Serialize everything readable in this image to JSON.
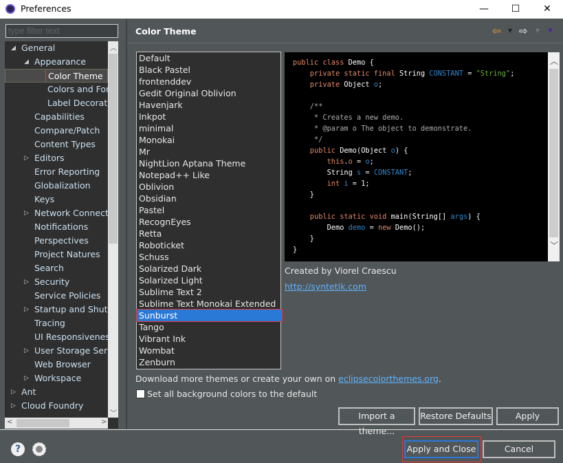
{
  "window": {
    "title": "Preferences",
    "minimize": "—",
    "maximize": "☐",
    "close": "✕"
  },
  "filter": {
    "placeholder": "type filter text"
  },
  "tree": [
    {
      "label": "General",
      "level": 0,
      "arrow": "expanded"
    },
    {
      "label": "Appearance",
      "level": 1,
      "arrow": "expanded"
    },
    {
      "label": "Color Theme",
      "level": 2,
      "selected": true
    },
    {
      "label": "Colors and Fonts",
      "level": 2
    },
    {
      "label": "Label Decorations",
      "level": 2
    },
    {
      "label": "Capabilities",
      "level": 1
    },
    {
      "label": "Compare/Patch",
      "level": 1
    },
    {
      "label": "Content Types",
      "level": 1
    },
    {
      "label": "Editors",
      "level": 1,
      "arrow": "collapsed"
    },
    {
      "label": "Error Reporting",
      "level": 1
    },
    {
      "label": "Globalization",
      "level": 1
    },
    {
      "label": "Keys",
      "level": 1
    },
    {
      "label": "Network Connections",
      "level": 1,
      "arrow": "collapsed"
    },
    {
      "label": "Notifications",
      "level": 1
    },
    {
      "label": "Perspectives",
      "level": 1
    },
    {
      "label": "Project Natures",
      "level": 1
    },
    {
      "label": "Search",
      "level": 1
    },
    {
      "label": "Security",
      "level": 1,
      "arrow": "collapsed"
    },
    {
      "label": "Service Policies",
      "level": 1
    },
    {
      "label": "Startup and Shutdown",
      "level": 1,
      "arrow": "collapsed"
    },
    {
      "label": "Tracing",
      "level": 1
    },
    {
      "label": "UI Responsiveness",
      "level": 1
    },
    {
      "label": "User Storage Service",
      "level": 1,
      "arrow": "collapsed"
    },
    {
      "label": "Web Browser",
      "level": 1
    },
    {
      "label": "Workspace",
      "level": 1,
      "arrow": "collapsed"
    },
    {
      "label": "Ant",
      "level": 0,
      "arrow": "collapsed"
    },
    {
      "label": "Cloud Foundry",
      "level": 0,
      "arrow": "collapsed"
    }
  ],
  "page": {
    "title": "Color Theme",
    "toolbar_icons": [
      "back-arrow-icon",
      "forward-arrow-icon",
      "view-menu-icon"
    ]
  },
  "themes": [
    "Default",
    "Black Pastel",
    "frontenddev",
    "Gedit Original Oblivion",
    "Havenjark",
    "Inkpot",
    "minimal",
    "Monokai",
    "Mr",
    "NightLion Aptana Theme",
    "Notepad++ Like",
    "Oblivion",
    "Obsidian",
    "Pastel",
    "RecognEyes",
    "Retta",
    "Roboticket",
    "Schuss",
    "Solarized Dark",
    "Solarized Light",
    "Sublime Text 2",
    "Sublime Text Monokai Extended",
    "Sunburst",
    "Tango",
    "Vibrant Ink",
    "Wombat",
    "Zenburn"
  ],
  "selected_theme": "Sunburst",
  "preview": {
    "code": [
      [
        [
          "kw",
          "public class "
        ],
        [
          "cls",
          "Demo"
        ],
        [
          "pl",
          " {"
        ]
      ],
      [
        [
          "kw",
          "    private static final "
        ],
        [
          "cls",
          "String "
        ],
        [
          "cst",
          "CONSTANT"
        ],
        [
          "pl",
          " = "
        ],
        [
          "str",
          "\"String\""
        ],
        [
          "pl",
          ";"
        ]
      ],
      [
        [
          "kw",
          "    private "
        ],
        [
          "cls",
          "Object "
        ],
        [
          "cst",
          "o"
        ],
        [
          "pl",
          ";"
        ]
      ],
      [
        [
          "pl",
          ""
        ]
      ],
      [
        [
          "cm",
          "    /**"
        ]
      ],
      [
        [
          "cm",
          "     * Creates a new demo."
        ]
      ],
      [
        [
          "cm",
          "     * @param o The object to demonstrate."
        ]
      ],
      [
        [
          "cm",
          "     */"
        ]
      ],
      [
        [
          "kw",
          "    public "
        ],
        [
          "cls",
          "Demo"
        ],
        [
          "pl",
          "("
        ],
        [
          "cls",
          "Object "
        ],
        [
          "cst",
          "o"
        ],
        [
          "pl",
          ") {"
        ]
      ],
      [
        [
          "kw",
          "        this"
        ],
        [
          "pl",
          "."
        ],
        [
          "kw",
          "o"
        ],
        [
          "pl",
          " = "
        ],
        [
          "cst",
          "o"
        ],
        [
          "pl",
          ";"
        ]
      ],
      [
        [
          "cls",
          "        String "
        ],
        [
          "cst",
          "s"
        ],
        [
          "pl",
          " = "
        ],
        [
          "cst",
          "CONSTANT"
        ],
        [
          "pl",
          ";"
        ]
      ],
      [
        [
          "kw",
          "        int "
        ],
        [
          "cst",
          "i"
        ],
        [
          "pl",
          " = 1;"
        ]
      ],
      [
        [
          "pl",
          "    }"
        ]
      ],
      [
        [
          "pl",
          ""
        ]
      ],
      [
        [
          "kw",
          "    public static void "
        ],
        [
          "cls",
          "main"
        ],
        [
          "pl",
          "("
        ],
        [
          "cls",
          "String"
        ],
        [
          "pl",
          "[] "
        ],
        [
          "cst",
          "args"
        ],
        [
          "pl",
          ") {"
        ]
      ],
      [
        [
          "cls",
          "        Demo "
        ],
        [
          "cst",
          "demo"
        ],
        [
          "pl",
          " = "
        ],
        [
          "kw",
          "new "
        ],
        [
          "cls",
          "Demo"
        ],
        [
          "pl",
          "();"
        ]
      ],
      [
        [
          "pl",
          "    }"
        ]
      ],
      [
        [
          "pl",
          "}"
        ]
      ]
    ]
  },
  "credit": "Created by Viorel Craescu",
  "credit_link": "http://syntetik.com",
  "download": {
    "text": "Download more themes or create your own on ",
    "link": "eclipsecolorthemes.org",
    "suffix": "."
  },
  "checkbox": {
    "label": "Set all background colors to the default",
    "checked": false
  },
  "buttons": {
    "import": "Import a theme...",
    "restore": "Restore Defaults",
    "apply": "Apply",
    "apply_close": "Apply and Close",
    "cancel": "Cancel"
  },
  "colors": {
    "background": "#515658",
    "list_bg": "#2f2f2f",
    "selection": "#2b79d6",
    "highlight": "#e53935"
  }
}
